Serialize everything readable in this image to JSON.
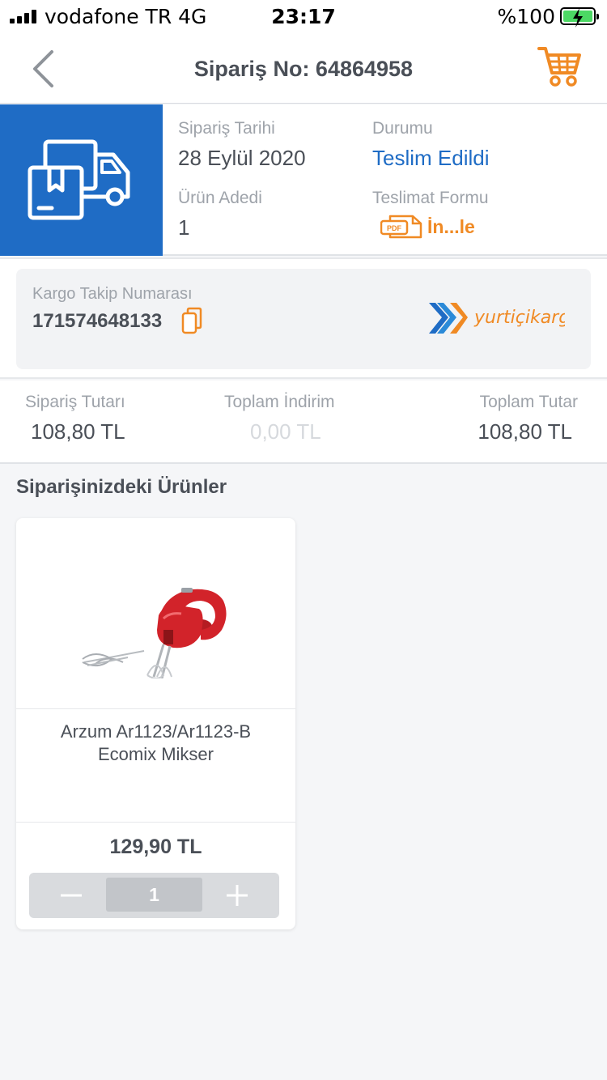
{
  "status_bar": {
    "carrier": "vodafone TR  4G",
    "time": "23:17",
    "battery": "%100"
  },
  "nav": {
    "title": "Sipariş No: 64864958"
  },
  "order": {
    "date_label": "Sipariş Tarihi",
    "date_value": "28 Eylül 2020",
    "status_label": "Durumu",
    "status_value": "Teslim Edildi",
    "count_label": "Ürün Adedi",
    "count_value": "1",
    "form_label": "Teslimat Formu",
    "form_link": "İn...le",
    "pdf_badge": "PDF"
  },
  "cargo": {
    "label": "Kargo Takip Numarası",
    "number": "171574648133",
    "logo_text": "yurtiçikargo"
  },
  "totals": {
    "order_label": "Sipariş Tutarı",
    "order_value": "108,80 TL",
    "discount_label": "Toplam İndirim",
    "discount_value": "0,00 TL",
    "total_label": "Toplam Tutar",
    "total_value": "108,80 TL"
  },
  "products": {
    "section_title": "Siparişinizdeki Ürünler",
    "items": [
      {
        "name": "Arzum Ar1123/Ar1123-B Ecomix Mikser",
        "price": "129,90 TL",
        "quantity": "1"
      }
    ]
  },
  "colors": {
    "brand_blue": "#1f6cc5",
    "accent_orange": "#f08a24"
  }
}
